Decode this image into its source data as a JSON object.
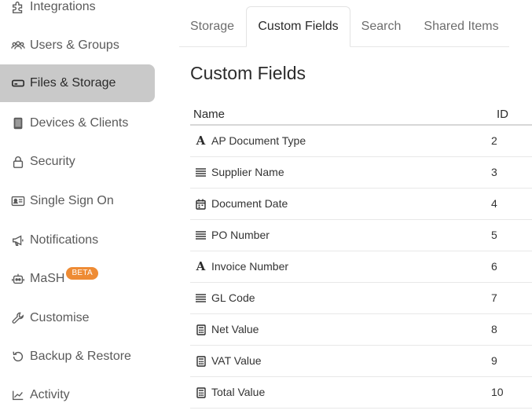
{
  "sidebar": {
    "items": [
      {
        "label": "Integrations",
        "icon": "puzzle-icon",
        "active": false
      },
      {
        "label": "Users & Groups",
        "icon": "users-icon",
        "active": false
      },
      {
        "label": "Files & Storage",
        "icon": "hard-drive-icon",
        "active": true
      },
      {
        "label": "Devices & Clients",
        "icon": "tablet-icon",
        "active": false
      },
      {
        "label": "Security",
        "icon": "lock-icon",
        "active": false
      },
      {
        "label": "Single Sign On",
        "icon": "id-card-icon",
        "active": false
      },
      {
        "label": "Notifications",
        "icon": "megaphone-icon",
        "active": false
      },
      {
        "label": "MaSH",
        "icon": "robot-icon",
        "active": false,
        "badge": "BETA"
      },
      {
        "label": "Customise",
        "icon": "wrench-icon",
        "active": false
      },
      {
        "label": "Backup & Restore",
        "icon": "restore-icon",
        "active": false
      },
      {
        "label": "Activity",
        "icon": "activity-icon",
        "active": false
      }
    ]
  },
  "tabs": [
    {
      "label": "Storage",
      "active": false
    },
    {
      "label": "Custom Fields",
      "active": true
    },
    {
      "label": "Search",
      "active": false
    },
    {
      "label": "Shared Items",
      "active": false
    }
  ],
  "page": {
    "title": "Custom Fields"
  },
  "table": {
    "columns": {
      "name": "Name",
      "id": "ID"
    },
    "rows": [
      {
        "name": "AP Document Type",
        "id": "2",
        "icon": "text-type-icon"
      },
      {
        "name": "Supplier Name",
        "id": "3",
        "icon": "lines-icon"
      },
      {
        "name": "Document Date",
        "id": "4",
        "icon": "calendar-icon"
      },
      {
        "name": "PO Number",
        "id": "5",
        "icon": "lines-icon"
      },
      {
        "name": "Invoice Number",
        "id": "6",
        "icon": "text-type-icon"
      },
      {
        "name": "GL Code",
        "id": "7",
        "icon": "lines-icon"
      },
      {
        "name": "Net Value",
        "id": "8",
        "icon": "calculator-icon"
      },
      {
        "name": "VAT Value",
        "id": "9",
        "icon": "calculator-icon"
      },
      {
        "name": "Total Value",
        "id": "10",
        "icon": "calculator-icon"
      }
    ]
  }
}
